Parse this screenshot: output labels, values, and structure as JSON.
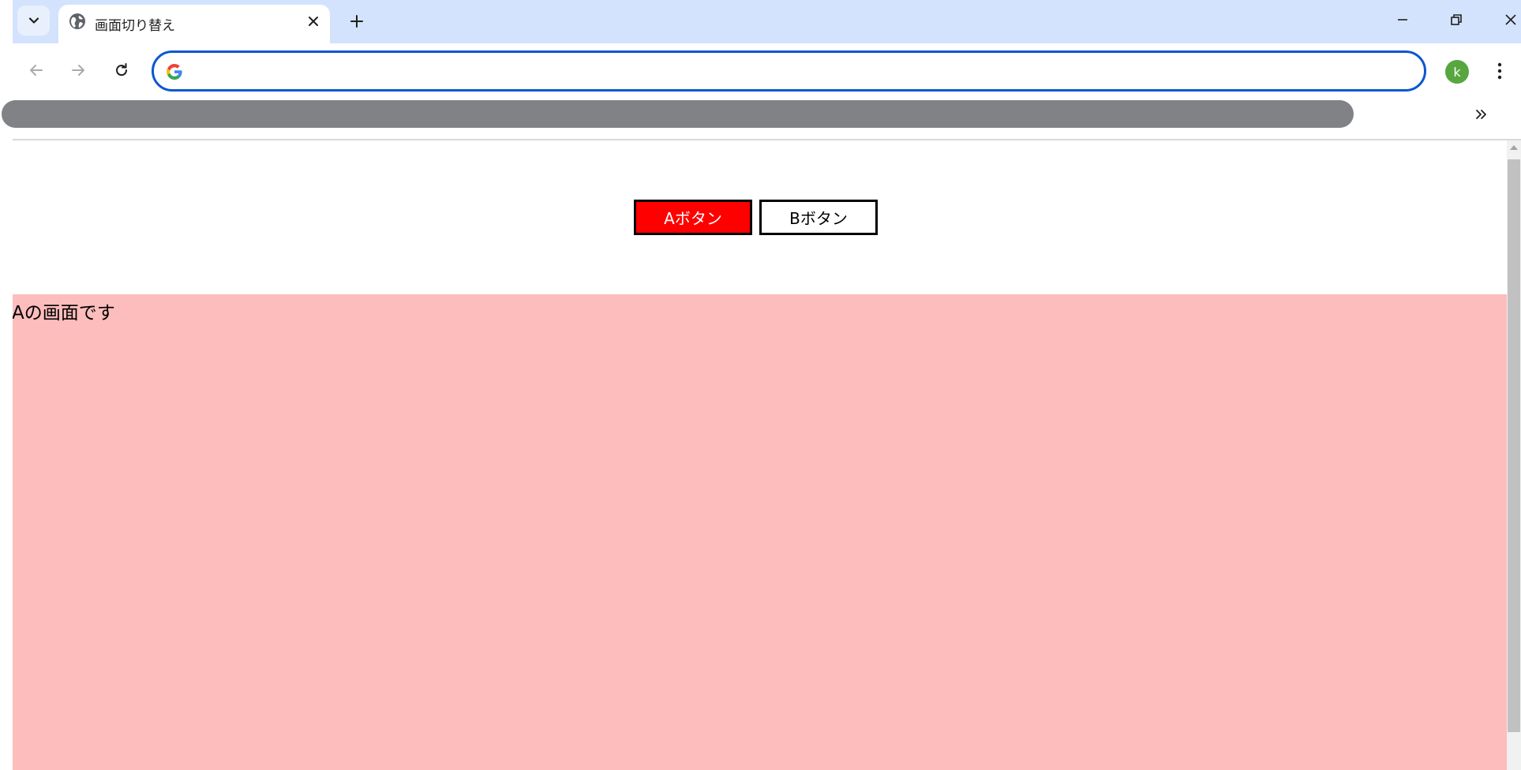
{
  "browser": {
    "tab": {
      "title": "画面切り替え"
    },
    "omnibox": {
      "value": "",
      "placeholder": ""
    },
    "profile": {
      "initial": "k",
      "color": "#57a63f"
    }
  },
  "page": {
    "buttons": [
      {
        "label": "Aボタン",
        "state": "active",
        "color": "#ff0000"
      },
      {
        "label": "Bボタン",
        "state": "inactive",
        "color": "#ffffff"
      }
    ],
    "panel": {
      "text": "Aの画面です",
      "color": "#fdbdbd"
    }
  }
}
